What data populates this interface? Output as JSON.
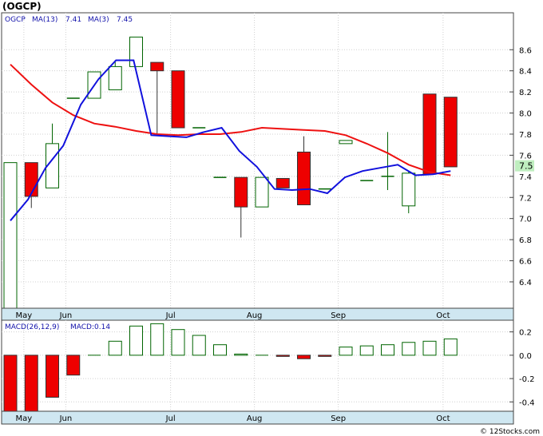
{
  "header": {
    "title": "(OGCP)"
  },
  "watermark": "© 12Stocks.com",
  "chart_data": [
    {
      "type": "candlestick",
      "legend": {
        "symbol": "OGCP",
        "ma13_label": "MA(13)",
        "ma13_value": "7.41",
        "ma3_label": "MA(3)",
        "ma3_value": "7.45"
      },
      "last_price_label": "7.5",
      "last_price": 7.5,
      "ylim": [
        6.15,
        8.95
      ],
      "yticks": [
        "6.4",
        "6.6",
        "6.8",
        "7.0",
        "7.2",
        "7.4",
        "7.6",
        "7.8",
        "8.0",
        "8.2",
        "8.4",
        "8.6"
      ],
      "month_labels": [
        {
          "label": "May",
          "index": 1.1
        },
        {
          "label": "Jun",
          "index": 3.1
        },
        {
          "label": "Jul",
          "index": 8.1
        },
        {
          "label": "Aug",
          "index": 12.1
        },
        {
          "label": "Sep",
          "index": 16.1
        },
        {
          "label": "Oct",
          "index": 21.1
        }
      ],
      "grid": true,
      "candles": [
        {
          "o": 6.15,
          "h": 7.53,
          "l": 6.15,
          "c": 7.53
        },
        {
          "o": 7.53,
          "h": 7.53,
          "l": 7.1,
          "c": 7.21
        },
        {
          "o": 7.29,
          "h": 7.9,
          "l": 7.29,
          "c": 7.71
        },
        {
          "o": 8.14,
          "h": 8.14,
          "l": 8.14,
          "c": 8.14
        },
        {
          "o": 8.14,
          "h": 8.39,
          "l": 8.14,
          "c": 8.39
        },
        {
          "o": 8.22,
          "h": 8.5,
          "l": 8.22,
          "c": 8.44
        },
        {
          "o": 8.44,
          "h": 8.72,
          "l": 8.44,
          "c": 8.72
        },
        {
          "o": 8.48,
          "h": 8.48,
          "l": 7.8,
          "c": 8.4
        },
        {
          "o": 8.4,
          "h": 8.4,
          "l": 7.86,
          "c": 7.86
        },
        {
          "o": 7.86,
          "h": 7.86,
          "l": 7.86,
          "c": 7.86
        },
        {
          "o": 7.39,
          "h": 7.39,
          "l": 7.39,
          "c": 7.39
        },
        {
          "o": 7.39,
          "h": 7.39,
          "l": 6.82,
          "c": 7.11
        },
        {
          "o": 7.11,
          "h": 7.39,
          "l": 7.11,
          "c": 7.39
        },
        {
          "o": 7.38,
          "h": 7.38,
          "l": 7.29,
          "c": 7.29
        },
        {
          "o": 7.63,
          "h": 7.78,
          "l": 7.13,
          "c": 7.13
        },
        {
          "o": 7.28,
          "h": 7.28,
          "l": 7.28,
          "c": 7.28
        },
        {
          "o": 7.71,
          "h": 7.74,
          "l": 7.71,
          "c": 7.74
        },
        {
          "o": 7.36,
          "h": 7.36,
          "l": 7.36,
          "c": 7.36
        },
        {
          "o": 7.4,
          "h": 7.82,
          "l": 7.27,
          "c": 7.4
        },
        {
          "o": 7.12,
          "h": 7.45,
          "l": 7.05,
          "c": 7.43
        },
        {
          "o": 8.18,
          "h": 8.18,
          "l": 7.42,
          "c": 7.42
        },
        {
          "o": 8.15,
          "h": 8.15,
          "l": 7.49,
          "c": 7.49
        }
      ],
      "ma13": [
        8.46,
        8.27,
        8.1,
        7.98,
        7.9,
        7.87,
        7.83,
        7.8,
        7.79,
        7.8,
        7.8,
        7.82,
        7.86,
        7.85,
        7.84,
        7.83,
        7.79,
        7.71,
        7.62,
        7.51,
        7.44,
        7.41
      ],
      "ma3": [
        6.98,
        7.18,
        7.48,
        7.69,
        8.08,
        8.32,
        8.5,
        8.5,
        7.79,
        7.78,
        7.77,
        7.82,
        7.86,
        7.64,
        7.49,
        7.28,
        7.27,
        7.28,
        7.24,
        7.39,
        7.45,
        7.48,
        7.51,
        7.41,
        7.42,
        7.45
      ],
      "colors": {
        "up_border": "#006400",
        "down_fill": "#ee0000",
        "ma13_line": "#ee1111",
        "ma3_line": "#1111dd",
        "price_tag_bg": "#bfeebf",
        "axis_band": "#cfe7f1"
      }
    },
    {
      "type": "bar",
      "legend": {
        "label": "MACD(26,12,9)",
        "value_label": "MACD:0.14"
      },
      "ylim": [
        -0.48,
        0.3
      ],
      "yticks": [
        "0.2",
        "0.0",
        "-0.2",
        "-0.4"
      ],
      "values": [
        -0.59,
        -0.52,
        -0.36,
        -0.17,
        0.0,
        0.12,
        0.25,
        0.27,
        0.22,
        0.17,
        0.09,
        0.01,
        0.0,
        -0.01,
        -0.03,
        -0.01,
        0.07,
        0.08,
        0.09,
        0.11,
        0.12,
        0.14
      ],
      "month_labels": [
        {
          "label": "May",
          "index": 1.1
        },
        {
          "label": "Jun",
          "index": 3.1
        },
        {
          "label": "Jul",
          "index": 8.1
        },
        {
          "label": "Aug",
          "index": 12.1
        },
        {
          "label": "Sep",
          "index": 16.1
        },
        {
          "label": "Oct",
          "index": 21.1
        }
      ]
    }
  ]
}
